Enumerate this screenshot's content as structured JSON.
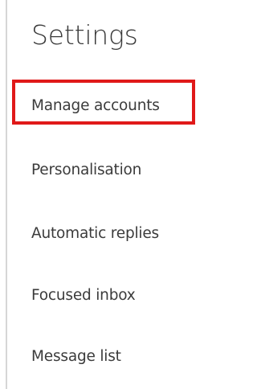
{
  "header": {
    "title": "Settings"
  },
  "nav": {
    "items": [
      {
        "label": "Manage accounts"
      },
      {
        "label": "Personalisation"
      },
      {
        "label": "Automatic replies"
      },
      {
        "label": "Focused inbox"
      },
      {
        "label": "Message list"
      }
    ]
  },
  "annotation": {
    "highlight_color": "#e01919"
  }
}
